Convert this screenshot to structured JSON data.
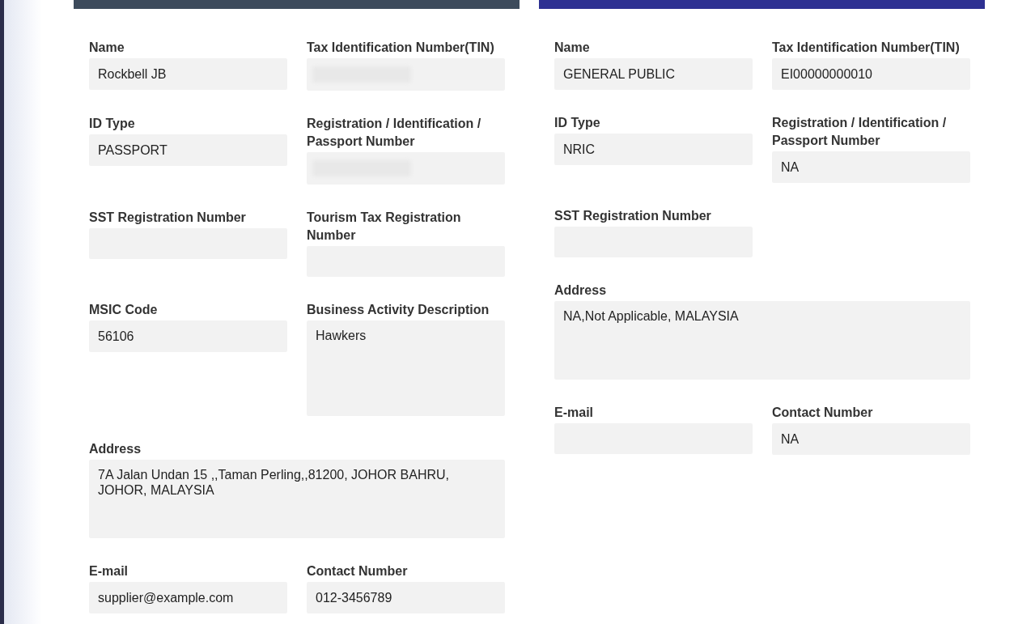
{
  "parties": [
    {
      "color": "#3d4b5c",
      "fields": [
        {
          "label": "Name",
          "kind": "input",
          "value": "Rockbell JB"
        },
        {
          "label": "Tax Identification Number(TIN)",
          "kind": "input",
          "redacted": true
        },
        {
          "label": "ID Type",
          "kind": "input",
          "value": "PASSPORT"
        },
        {
          "label": "Registration / Identification / Passport Number",
          "kind": "input",
          "redacted": true
        },
        {
          "label": "SST Registration Number",
          "kind": "input"
        },
        {
          "label": "Tourism Tax Registration Number",
          "kind": "input"
        },
        {
          "label": "MSIC Code",
          "kind": "input",
          "value": "56106"
        },
        {
          "label": "Business Activity Description",
          "kind": "textarea",
          "value": "Hawkers"
        },
        {
          "label": "Address",
          "kind": "textarea",
          "wide": true,
          "value": "7A Jalan Undan 15 ,,Taman Perling,,81200, JOHOR BAHRU, JOHOR, MALAYSIA"
        },
        {
          "label": "E-mail",
          "kind": "input",
          "value": "supplier@example.com"
        },
        {
          "label": "Contact Number",
          "kind": "input",
          "value": "012-3456789"
        }
      ]
    },
    {
      "color": "#2e3192",
      "fields": [
        {
          "label": "Name",
          "kind": "input",
          "value": "GENERAL PUBLIC"
        },
        {
          "label": "Tax Identification Number(TIN)",
          "kind": "input",
          "value": "EI00000000010"
        },
        {
          "label": "ID Type",
          "kind": "input",
          "value": "NRIC"
        },
        {
          "label": "Registration / Identification / Passport Number",
          "kind": "input",
          "value": "NA"
        },
        {
          "label": "SST Registration Number",
          "kind": "input"
        },
        {
          "label": "Address",
          "kind": "textarea",
          "wide": true,
          "value": "NA,Not Applicable, MALAYSIA"
        },
        {
          "label": "E-mail",
          "kind": "input"
        },
        {
          "label": "Contact Number",
          "kind": "input",
          "value": "NA"
        }
      ]
    }
  ]
}
